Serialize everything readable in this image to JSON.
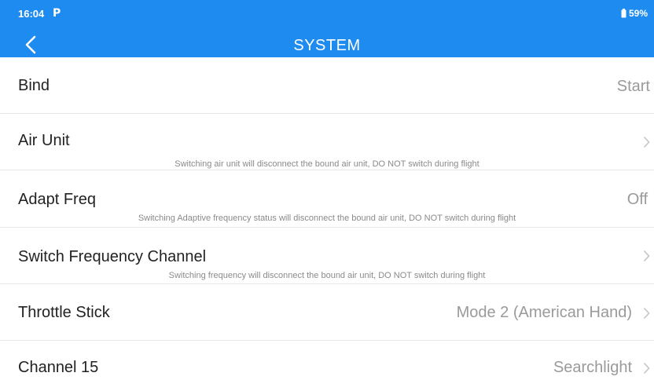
{
  "status_bar": {
    "time": "16:04",
    "app_icon": "P",
    "battery": "59%"
  },
  "header": {
    "title": "SYSTEM",
    "back_icon": "chevron-left-icon"
  },
  "rows": [
    {
      "label": "Bind",
      "value": "Start",
      "hint": ""
    },
    {
      "label": "Air Unit",
      "value": "",
      "hint": "Switching air unit will disconnect the bound air unit, DO NOT switch during flight"
    },
    {
      "label": "Adapt Freq",
      "value": "Off",
      "hint": "Switching Adaptive frequency status will disconnect the bound air unit, DO NOT switch during flight"
    },
    {
      "label": "Switch Frequency Channel",
      "value": "",
      "hint": "Switching frequency will disconnect the bound air unit, DO NOT switch during flight"
    },
    {
      "label": "Throttle Stick",
      "value": "Mode 2 (American Hand)",
      "hint": ""
    },
    {
      "label": "Channel 15",
      "value": "Searchlight",
      "hint": ""
    }
  ],
  "colors": {
    "header": "#1e8bf0",
    "label": "#222222",
    "value": "#9a9a9a",
    "hint": "#8a8a8a",
    "divider": "#e6e6e6"
  }
}
